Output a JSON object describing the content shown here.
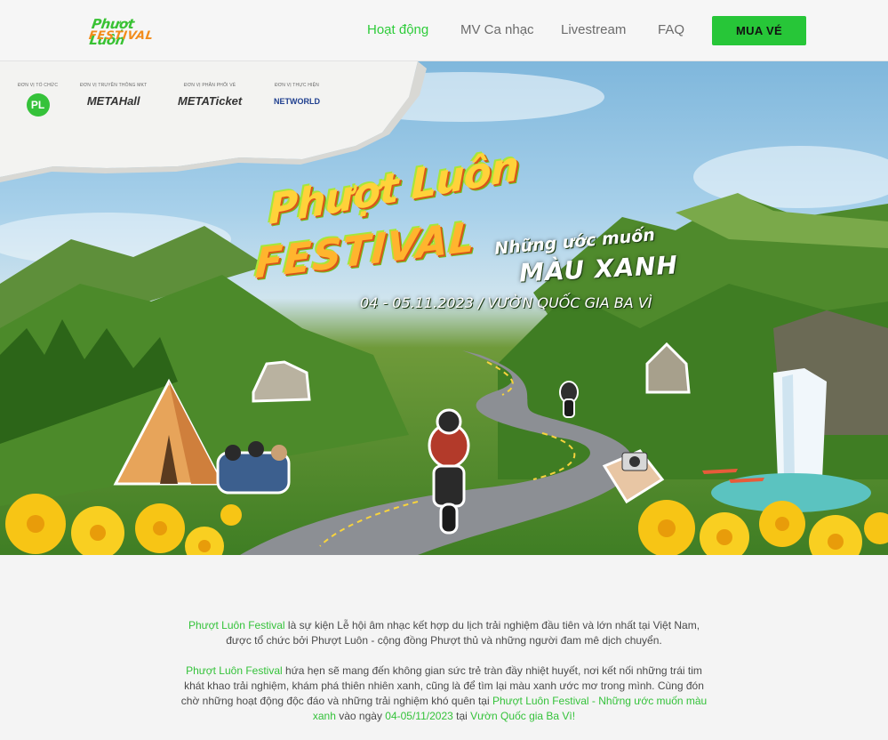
{
  "nav": {
    "logo_line1": "Phượt Luôn",
    "logo_line2": "FESTIVAL",
    "links": [
      "Hoạt động",
      "MV Ca nhạc",
      "Livestream",
      "FAQ"
    ],
    "cta": "MUA VÉ"
  },
  "hero": {
    "sponsors": [
      {
        "caption": "ĐƠN VỊ TỔ CHỨC",
        "logo": "PL"
      },
      {
        "caption": "ĐƠN VỊ TRUYỀN THÔNG MKT",
        "logo": "METAHall"
      },
      {
        "caption": "ĐƠN VỊ PHÂN PHỐI VÉ",
        "logo": "METATicket"
      },
      {
        "caption": "ĐƠN VỊ THỰC HIỆN",
        "logo": "NETWORLD"
      }
    ],
    "title_line1": "Phượt Luôn",
    "title_line2": "FESTIVAL",
    "subtitle_line1": "Những ước muốn",
    "subtitle_line2": "MÀU XANH",
    "date_location": "04 - 05.11.2023  /  VƯỜN QUỐC GIA BA VÌ"
  },
  "content": {
    "p1_highlight": "Phượt Luôn Festival",
    "p1_text": " là sự kiện Lễ hội âm nhạc kết hợp du lịch trải nghiệm đầu tiên và lớn nhất tại Việt Nam, được tổ chức bởi Phượt Luôn - cộng đồng Phượt thủ và những người đam mê dịch chuyển.",
    "p2_highlight": "Phượt Luôn Festival",
    "p2_text": " hứa hẹn sẽ mang đến không gian sức trẻ tràn đầy nhiệt huyết, nơi kết nối những trái tim khát khao trải nghiệm, khám phá thiên nhiên xanh, cũng là để tìm lại màu xanh ước mơ trong mình. Cùng đón chờ những hoạt động độc đáo và những trải nghiệm khó quên tại ",
    "p2_highlight2": "Phượt Luôn Festival - Những ước muốn màu xanh",
    "p2_text2": " vào ngày ",
    "p2_date": "04-05/11/2023",
    "p2_text3": " tại ",
    "p2_venue": "Vườn Quốc gia Ba Vì!"
  }
}
